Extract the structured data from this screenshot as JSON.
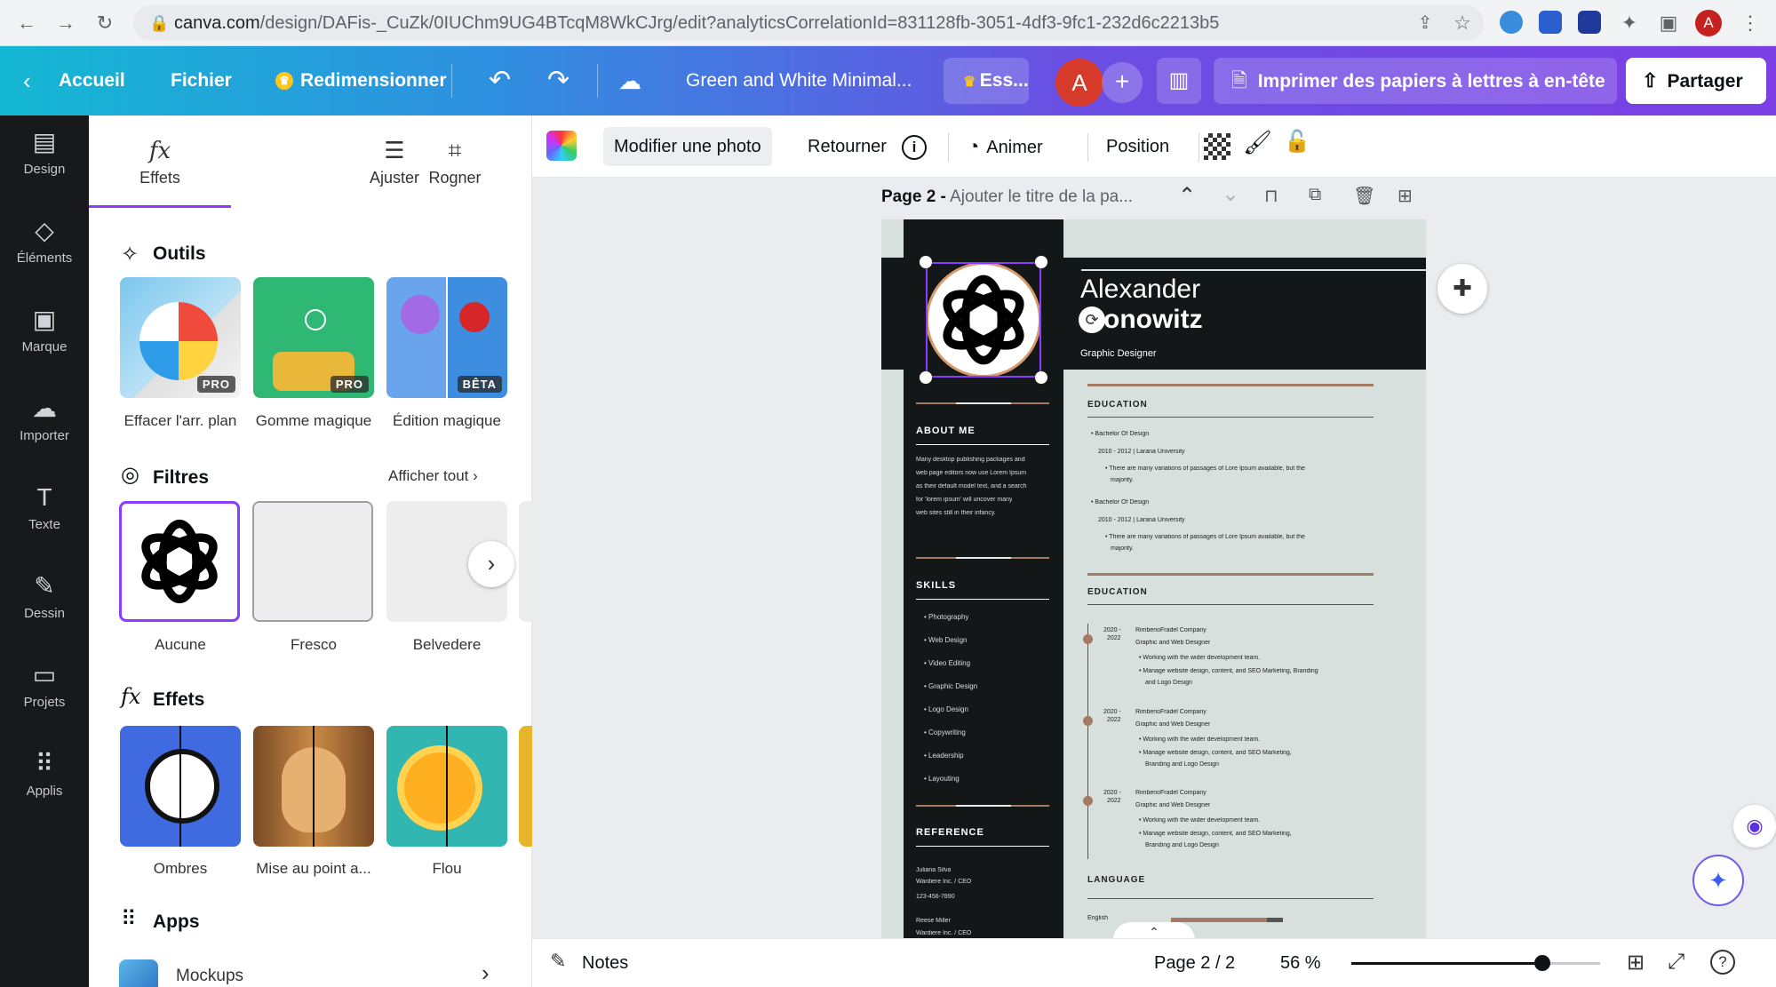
{
  "browser": {
    "url_domain": "canva.com",
    "url_path": "/design/DAFis-_CuZk/0IUChm9UG4BTcqM8WkCJrg/edit?analyticsCorrelationId=831128fb-3051-4df3-9fc1-232d6c2213b5",
    "avatar_letter": "A"
  },
  "header": {
    "home": "Accueil",
    "file": "Fichier",
    "resize": "Redimensionner",
    "doc_title": "Green and White Minimal...",
    "trial": "Ess...",
    "avatar_letter": "A",
    "print": "Imprimer des papiers à lettres à en-tête",
    "share": "Partager"
  },
  "rail": [
    {
      "label": "Design",
      "icon": "layout-icon"
    },
    {
      "label": "Éléments",
      "icon": "shapes-icon"
    },
    {
      "label": "Marque",
      "icon": "brand-icon"
    },
    {
      "label": "Importer",
      "icon": "upload-cloud-icon"
    },
    {
      "label": "Texte",
      "icon": "text-icon"
    },
    {
      "label": "Dessin",
      "icon": "pen-icon"
    },
    {
      "label": "Projets",
      "icon": "folder-icon"
    },
    {
      "label": "Applis",
      "icon": "grid-icon"
    }
  ],
  "panel": {
    "tabs": [
      "Effets",
      "Ajuster",
      "Rogner"
    ],
    "tools_title": "Outils",
    "tools": [
      {
        "label": "Effacer l'arr. plan",
        "badge": "PRO"
      },
      {
        "label": "Gomme magique",
        "badge": "PRO"
      },
      {
        "label": "Édition magique",
        "badge": "BÊTA"
      }
    ],
    "filters_title": "Filtres",
    "filters_see_all": "Afficher tout",
    "filters": [
      "Aucune",
      "Fresco",
      "Belvedere"
    ],
    "effects_title": "Effets",
    "effects": [
      "Ombres",
      "Mise au point a...",
      "Flou"
    ],
    "apps_title": "Apps",
    "apps": [
      "Mockups"
    ]
  },
  "toolbar": {
    "edit_photo": "Modifier une photo",
    "flip": "Retourner",
    "animate": "Animer",
    "position": "Position"
  },
  "page_header": {
    "page": "Page 2 -",
    "title_placeholder": "Ajouter le titre de la pa..."
  },
  "resume": {
    "first_name": "Alexander",
    "last_name": "Aaronowitz",
    "last_name_visible": "onowitz",
    "role": "Graphic Designer",
    "about_title": "ABOUT ME",
    "about_text": [
      "Many desktop publishing packages and",
      "web page editors now use Lorem Ipsum",
      "as their default model text, and a search",
      "for 'lorem ipsum' will uncover many",
      "web sites still in their infancy."
    ],
    "skills_title": "SKILLS",
    "skills": [
      "Photography",
      "Web Design",
      "Video Editing",
      "Graphic Design",
      "Logo Design",
      "Copywriting",
      "Leadership",
      "Layouting"
    ],
    "reference_title": "REFERENCE",
    "references": [
      [
        "Juliana Silva",
        "Wardiere Inc. / CEO",
        "123-456-7890"
      ],
      [
        "Reese Miller",
        "Wardiere Inc. / CEO"
      ]
    ],
    "education_title": "EDUCATION",
    "education": [
      {
        "degree": "Bachelor Of Design",
        "years": "2010 - 2012 | Larana University",
        "desc1": "There are many variations of passages of Lore Ipsum available, but the",
        "desc2": "majority."
      },
      {
        "degree": "Bachelor Of Design",
        "years": "2010 - 2012 | Larana University",
        "desc1": "There are many variations of passages of Lore Ipsum available, but the",
        "desc2": "majority."
      }
    ],
    "experience_title": "EDUCATION",
    "experience": [
      {
        "y1": "2020 -",
        "y2": "2022",
        "company": "RimberioFradel Company",
        "role": "Graphic and Web Designer",
        "b1": "Working with the wider development team.",
        "b2": "Manage website design, content, and SEO Marketing, Branding",
        "b3": "and Logo Design"
      },
      {
        "y1": "2020 -",
        "y2": "2022",
        "company": "RimberioFradel Company",
        "role": "Graphic and Web Designer",
        "b1": "Working with the wider development team.",
        "b2": "Manage website design, content, and SEO Marketing,",
        "b3": "Branding and Logo Design"
      },
      {
        "y1": "2020 -",
        "y2": "2022",
        "company": "RimberioFradel Company",
        "role": "Graphic and Web Designer",
        "b1": "Working with the wider development team.",
        "b2": "Manage website design, content, and SEO Marketing,",
        "b3": "Branding and Logo Design"
      }
    ],
    "language_title": "LANGUAGE",
    "languages": [
      "English"
    ]
  },
  "bottombar": {
    "notes": "Notes",
    "page_indicator": "Page 2 / 2",
    "zoom": "56 %",
    "help": "?",
    "zoom_level": 0.56
  },
  "colors": {
    "accent_purple": "#8b3dff",
    "resume_dark": "#141717",
    "resume_light": "#d7e0dd",
    "resume_brown": "#a57a64"
  }
}
